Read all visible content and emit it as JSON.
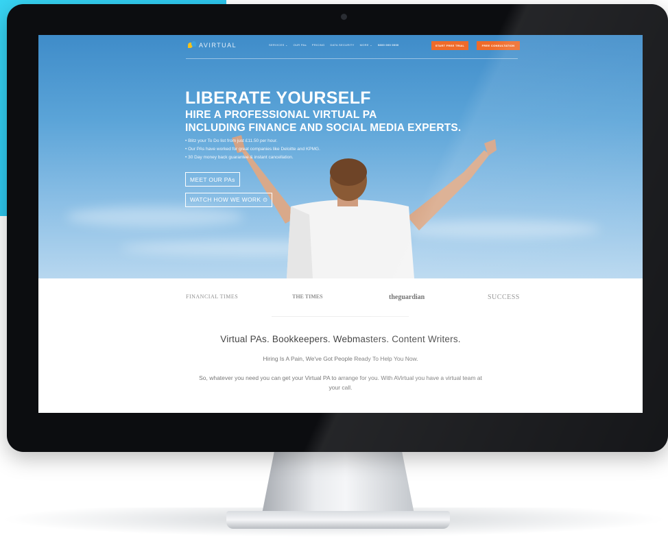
{
  "brand": {
    "logo_text": "AVIRTUAL",
    "accent_orange": "#ef6b2a",
    "accent_cyan": "#23b9ea"
  },
  "nav": {
    "links": [
      "SERVICES ⌄",
      "OUR PAs",
      "PRICING",
      "DATA SECURITY",
      "MORE ⌄",
      "0800 000 0000"
    ],
    "cta_trial": "START FREE TRIAL",
    "cta_consult": "FREE CONSULTATION"
  },
  "hero": {
    "title": "LIBERATE YOURSELF",
    "subtitle_1": "HIRE A PROFESSIONAL VIRTUAL PA",
    "subtitle_2": "INCLUDING FINANCE AND SOCIAL MEDIA EXPERTS.",
    "bullets": [
      "Blitz your To Do list from just £11.50 per hour.",
      "Our PAs have worked for great companies like Deloitte and KPMG.",
      "30 Day money back guarantee & instant cancellation."
    ],
    "button_meet": "MEET OUR PAs",
    "button_watch": "WATCH HOW WE WORK ⊙"
  },
  "press": {
    "logos": [
      "FINANCIAL TIMES",
      "THE TIMES",
      "theguardian",
      "SUCCESS"
    ]
  },
  "content": {
    "tagline": "Virtual PAs. Bookkeepers. Webmasters. Content Writers.",
    "subtag": "Hiring Is A Pain, We've Got People Ready To Help You Now.",
    "body": "So, whatever you need you can get your Virtual PA to arrange for you. With AVirtual you have a virtual team at your call."
  }
}
